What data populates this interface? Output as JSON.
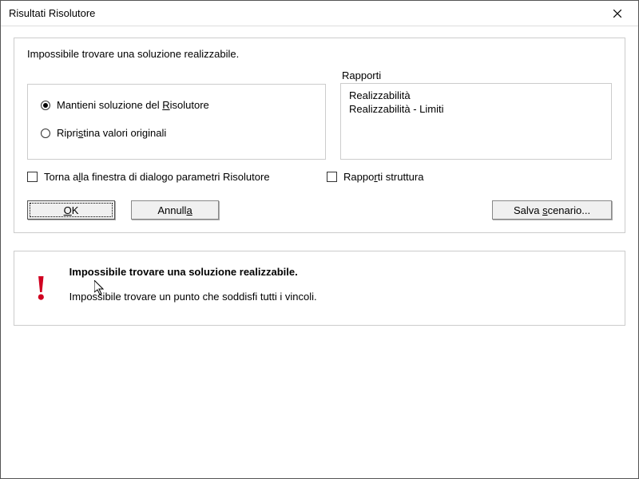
{
  "window": {
    "title": "Risultati Risolutore"
  },
  "status_text": "Impossibile trovare una soluzione realizzabile.",
  "options": {
    "keep_pre": "Mantieni soluzione del ",
    "keep_und": "R",
    "keep_post": "isolutore",
    "restore_pre": "Ripri",
    "restore_und": "s",
    "restore_post": "tina valori originali"
  },
  "reports": {
    "label": "Rapporti",
    "items": [
      "Realizzabilità",
      "Realizzabilità - Limiti"
    ]
  },
  "checks": {
    "return_pre": "Torna a",
    "return_und": "l",
    "return_post": "la finestra di dialogo parametri Risolutore",
    "struct_pre": "Rappo",
    "struct_und": "r",
    "struct_post": "ti struttura"
  },
  "buttons": {
    "ok_und": "O",
    "ok_post": "K",
    "cancel_pre": "Annull",
    "cancel_und": "a",
    "save_pre": "Salva ",
    "save_und": "s",
    "save_post": "cenario..."
  },
  "message": {
    "title": "Impossibile trovare una soluzione realizzabile.",
    "body": "Impossibile trovare un punto che soddisfi tutti i vincoli."
  }
}
